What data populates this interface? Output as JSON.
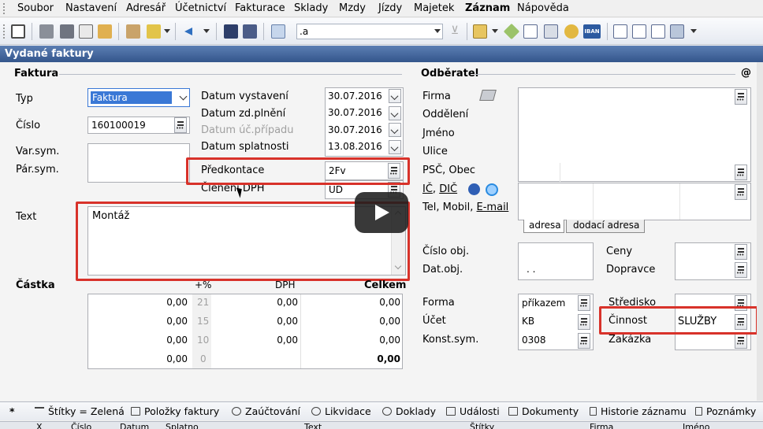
{
  "menu": {
    "items": [
      "Soubor",
      "Nastavení",
      "Adresář",
      "Účetnictví",
      "Fakturace",
      "Sklady",
      "Mzdy",
      "Jízdy",
      "Majetek",
      "Záznam",
      "Nápověda"
    ]
  },
  "toolbar": {
    "search_value": ".a"
  },
  "window": {
    "title": "Vydané faktury"
  },
  "faktura": {
    "section": "Faktura",
    "typ_label": "Typ",
    "typ_value": "Faktura",
    "cislo_label": "Číslo",
    "cislo_value": "160100019",
    "varsym_label": "Var.sym.",
    "parsym_label": "Pár.sym.",
    "text_label": "Text",
    "text_value": "Montáž"
  },
  "dates": {
    "vystaveni_label": "Datum vystavení",
    "vystaveni_value": "30.07.2016",
    "zdplneni_label": "Datum zd.plnění",
    "zdplneni_value": "30.07.2016",
    "ucpripadu_label": "Datum úč.případu",
    "ucpripadu_value": "30.07.2016",
    "splatnosti_label": "Datum splatnosti",
    "splatnosti_value": "13.08.2016",
    "predkontace_label": "Předkontace",
    "predkontace_value": "2Fv",
    "cleneni_label": "Členění DPH",
    "cleneni_value": "UD"
  },
  "castka": {
    "section": "Částka",
    "col_pct": "+%",
    "col_dph": "DPH",
    "col_celkem": "Celkem",
    "rows": [
      {
        "base": "0,00",
        "pct": "21",
        "dph": "0,00",
        "celkem": "0,00"
      },
      {
        "base": "0,00",
        "pct": "15",
        "dph": "0,00",
        "celkem": "0,00"
      },
      {
        "base": "0,00",
        "pct": "10",
        "dph": "0,00",
        "celkem": "0,00"
      },
      {
        "base": "0,00",
        "pct": "0",
        "dph": "",
        "celkem": "0,00"
      }
    ]
  },
  "odberatel": {
    "section": "Odběratel",
    "at": "@",
    "firma_label": "Firma",
    "oddeleni_label": "Oddělení",
    "jmeno_label": "Jméno",
    "ulice_label": "Ulice",
    "psc_label": "PSČ, Obec",
    "ic_label": "IČ",
    "dic_label": "DIČ",
    "tel_label": "Tel, Mobil,",
    "email_label": "E-mail",
    "tab_adresa": "adresa",
    "tab_dodaci": "dodací adresa"
  },
  "objednavka": {
    "cislo_obj_label": "Číslo obj.",
    "dat_obj_label": "Dat.obj.",
    "dat_obj_value": ". .",
    "ceny_label": "Ceny",
    "dopravce_label": "Dopravce"
  },
  "platba": {
    "forma_label": "Forma",
    "forma_value": "příkazem",
    "ucet_label": "Účet",
    "ucet_value": "KB",
    "konst_label": "Konst.sym.",
    "konst_value": "0308",
    "stredisko_label": "Středisko",
    "cinnost_label": "Činnost",
    "cinnost_value": "SLUŽBY",
    "zakazka_label": "Zakázka"
  },
  "bottom_tabs": [
    "Štítky = Zelená",
    "Položky faktury",
    "Zaúčtování",
    "Likvidace",
    "Doklady",
    "Události",
    "Dokumenty",
    "Historie záznamu",
    "Poznámky"
  ],
  "grid_columns": [
    "X",
    "Číslo",
    "Datum",
    "Splatno",
    "Text",
    "Štítky",
    "Firma",
    "Jméno"
  ],
  "colors": {
    "highlight": "#d8322a",
    "title_bar": "#34568c",
    "selection": "#3a78d6"
  }
}
